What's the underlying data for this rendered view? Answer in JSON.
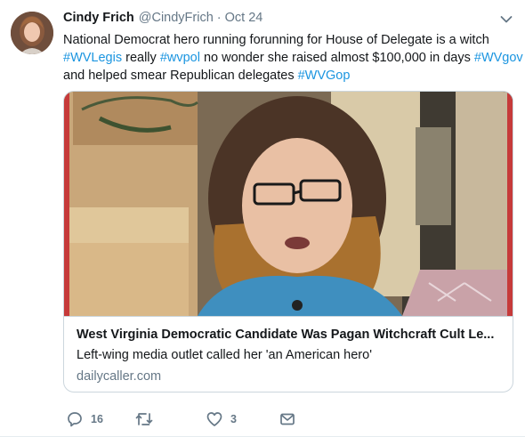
{
  "tweet": {
    "author_name": "Cindy Frich",
    "author_handle": "@CindyFrich",
    "separator": "·",
    "time": "Oct 24",
    "text": {
      "line1": "National Democrat hero running forunning for House of Delegate is a  witch",
      "line2_tag1": "#WVLegis",
      "line2_mid1": " really ",
      "line2_tag2": "#wvpol",
      "line2_mid2": " no wonder she raised almost $100,000 in days ",
      "line2_tag3": "#WVgov",
      "line3_text": "and helped smear Republican delegates ",
      "line3_tag": "#WVGop"
    }
  },
  "card": {
    "title": "West Virginia Democratic Candidate Was Pagan Witchcraft Cult Le...",
    "description": "Left-wing media outlet called her 'an American hero'",
    "domain": "dailycaller.com"
  },
  "actions": {
    "reply_count": "16",
    "retweet_count": "",
    "like_count": "3",
    "icons": [
      "reply-icon",
      "retweet-icon",
      "like-icon",
      "direct-message-icon"
    ]
  },
  "colors": {
    "hashtag": "#1b95e0",
    "secondary_text": "#657786",
    "border": "#ccd6dd"
  }
}
